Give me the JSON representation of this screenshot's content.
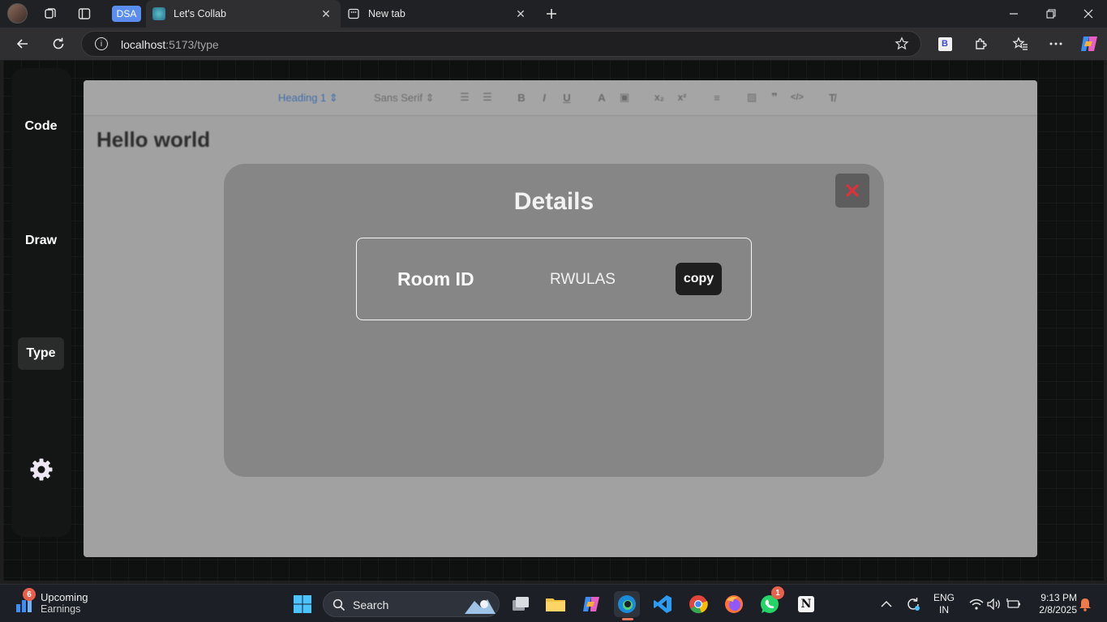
{
  "browser": {
    "tabs": [
      {
        "label": "DSA"
      },
      {
        "label": "Let's Collab"
      },
      {
        "label": "New tab"
      }
    ],
    "url_host": "localhost",
    "url_path": ":5173/type",
    "extension_label": "B"
  },
  "sidebar": {
    "items": [
      {
        "label": "Code"
      },
      {
        "label": "Draw"
      },
      {
        "label": "Type"
      }
    ]
  },
  "editor": {
    "toolbar": {
      "heading": "Heading 1",
      "font": "Sans Serif"
    },
    "content_heading": "Hello world"
  },
  "modal": {
    "title": "Details",
    "room_label": "Room ID",
    "room_value": "RWULAS",
    "copy_label": "copy"
  },
  "taskbar": {
    "weather_badge": "6",
    "weather_title": "Upcoming",
    "weather_subtitle": "Earnings",
    "search_label": "Search",
    "whatsapp_badge": "1",
    "lang_top": "ENG",
    "lang_bottom": "IN",
    "time": "9:13 PM",
    "date": "2/8/2025"
  },
  "colors": {
    "accent_blue": "#5b8def",
    "close_red": "#e0303a",
    "modal_bg": "#868686"
  }
}
